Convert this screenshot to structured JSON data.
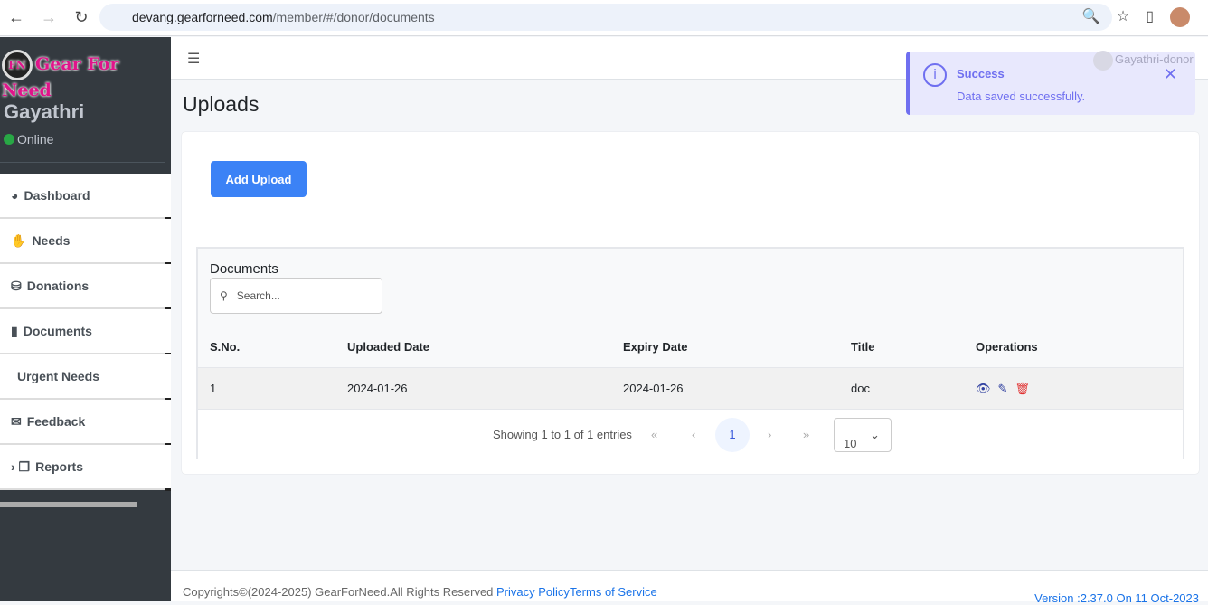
{
  "browser": {
    "url_host": "devang.gearforneed.com",
    "url_path": "/member/#/donor/documents"
  },
  "sidebar": {
    "logo": "Gear For Need",
    "logo_initials": "FN",
    "user": "Gayathri",
    "status": "Online",
    "items": [
      {
        "label": "Dashboard",
        "icon": "◕"
      },
      {
        "label": "Needs",
        "icon": "✋"
      },
      {
        "label": "Donations",
        "icon": "⛁"
      },
      {
        "label": "Documents",
        "icon": "▮"
      },
      {
        "label": "Urgent Needs",
        "icon": ""
      },
      {
        "label": "Feedback",
        "icon": "✉"
      },
      {
        "label": "Reports",
        "icon": "› ❐"
      }
    ]
  },
  "topbar": {
    "user": "Gayathri-donor"
  },
  "page": {
    "title": "Uploads",
    "add_button": "Add Upload"
  },
  "table": {
    "caption": "Documents",
    "search_placeholder": "Search...",
    "columns": [
      "S.No.",
      "Uploaded Date",
      "Expiry Date",
      "Title",
      "Operations"
    ],
    "rows": [
      [
        "1",
        "2024-01-26",
        "2024-01-26",
        "doc"
      ]
    ],
    "info": "Showing 1 to 1 of 1 entries",
    "page": "1",
    "page_size": "10"
  },
  "toast": {
    "title": "Success",
    "message": "Data saved successfully.",
    "color": "#6f6ff0"
  },
  "footer": {
    "copyright": "Copyrights©(2024-2025) GearForNeed.All Rights Reserved ",
    "privacy": "Privacy Policy",
    "terms": "Terms of Service",
    "version": "Version :2.37.0 On 11 Oct-2023"
  }
}
